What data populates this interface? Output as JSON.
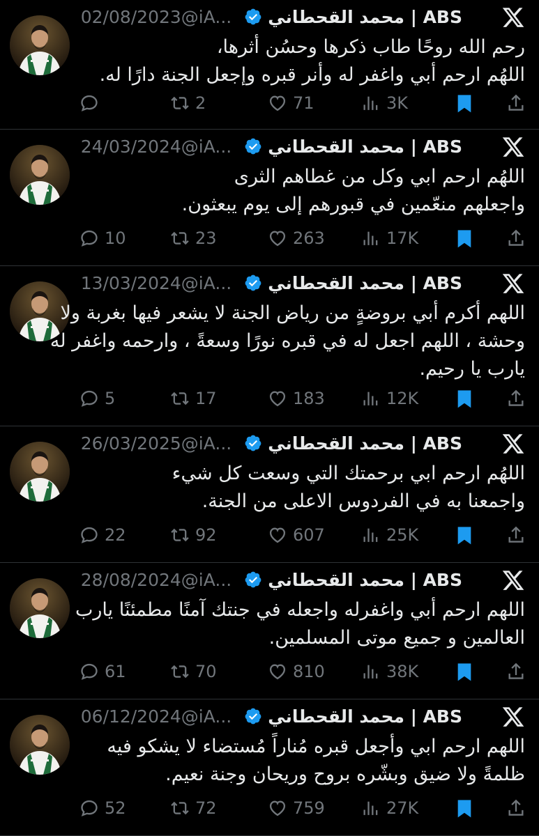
{
  "author": {
    "name": "ABS | محمد القحطاني",
    "handle": "@iA...",
    "verified_color": "#1d9bf0"
  },
  "colors": {
    "background": "#000000",
    "text": "#e7e9ea",
    "muted": "#71767b",
    "accent": "#1d9bf0",
    "divider": "#2f3336"
  },
  "tweets": [
    {
      "date": "02/08/2023",
      "lines": [
        "رحم الله روحًا طاب ذكرها وحسُن أثرها،",
        "اللهُم ارحم أبي واغفر له وأنر قبره وإجعل الجنة دارًا له."
      ],
      "replies": "",
      "retweets": "2",
      "likes": "71",
      "views": "3K"
    },
    {
      "date": "24/03/2024",
      "lines": [
        "اللهُم ارحم ابي وكل من غطاهم الثرى",
        "واجعلهم منعّمين في قبورهم إلى يوم يبعثون."
      ],
      "replies": "10",
      "retweets": "23",
      "likes": "263",
      "views": "17K"
    },
    {
      "date": "13/03/2024",
      "lines": [
        "اللهم أكرم أبي بروضةٍ من رياض الجنة لا يشعر فيها بغربة ولا",
        "وحشة ، اللهم اجعل له في قبره نورًا وسعةً ، وارحمه واغفر له",
        "يارب يا رحيم."
      ],
      "replies": "5",
      "retweets": "17",
      "likes": "183",
      "views": "12K"
    },
    {
      "date": "26/03/2025",
      "lines": [
        "اللهُم ارحم ابي برحمتك التي وسعت كل شيء",
        "واجمعنا به في الفردوس الاعلى من الجنة."
      ],
      "replies": "22",
      "retweets": "92",
      "likes": "607",
      "views": "25K"
    },
    {
      "date": "28/08/2024",
      "lines": [
        "اللهم ارحم أبي واغفرله واجعله في جنتك آمنًا مطمئنًا يارب",
        "العالمين و جميع موتى المسلمين."
      ],
      "replies": "61",
      "retweets": "70",
      "likes": "810",
      "views": "38K"
    },
    {
      "date": "06/12/2024",
      "lines": [
        "اللهم ارحم ابي وأجعل قبره مُناراً مُستضاء لا يشكو فيه",
        "ظلمةً ولا ضيق وبشّره بروح وريحان وجنة نعيم."
      ],
      "replies": "52",
      "retweets": "72",
      "likes": "759",
      "views": "27K"
    }
  ]
}
